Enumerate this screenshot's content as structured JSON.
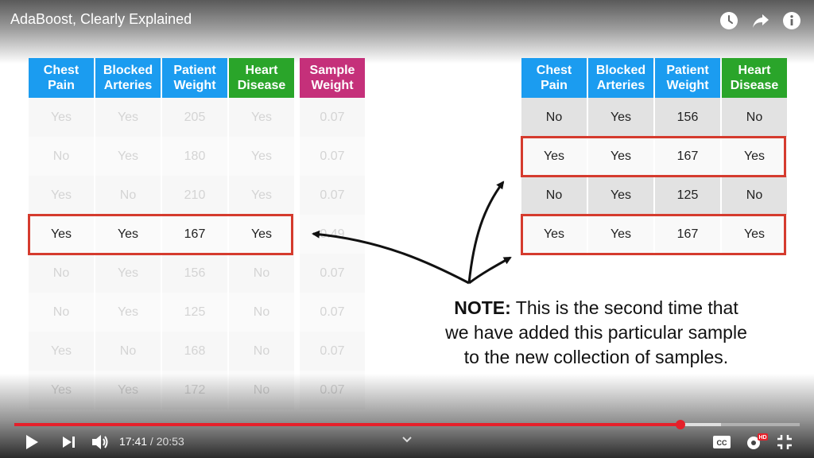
{
  "player": {
    "video_title": "AdaBoost, Clearly Explained",
    "current_time": "17:41",
    "separator": " / ",
    "duration": "20:53",
    "progress_fraction": 0.848,
    "buffered_fraction": 0.9,
    "hd_badge": "HD",
    "icons": [
      "clock-icon",
      "share-icon",
      "info-icon",
      "play-icon",
      "next-icon",
      "volume-icon",
      "chevron-down-icon",
      "captions-icon",
      "settings-icon",
      "exit-fullscreen-icon"
    ],
    "accent_color": "#e5202a"
  },
  "left_table": {
    "headers": [
      {
        "line1": "Chest",
        "line2": "Pain"
      },
      {
        "line1": "Blocked",
        "line2": "Arteries"
      },
      {
        "line1": "Patient",
        "line2": "Weight"
      },
      {
        "line1": "Heart",
        "line2": "Disease"
      }
    ],
    "rows": [
      [
        "Yes",
        "Yes",
        "205",
        "Yes"
      ],
      [
        "No",
        "Yes",
        "180",
        "Yes"
      ],
      [
        "Yes",
        "No",
        "210",
        "Yes"
      ],
      [
        "Yes",
        "Yes",
        "167",
        "Yes"
      ],
      [
        "No",
        "Yes",
        "156",
        "No"
      ],
      [
        "No",
        "Yes",
        "125",
        "No"
      ],
      [
        "Yes",
        "No",
        "168",
        "No"
      ],
      [
        "Yes",
        "Yes",
        "172",
        "No"
      ]
    ],
    "highlighted_row": 3
  },
  "weight_table": {
    "header": {
      "line1": "Sample",
      "line2": "Weight"
    },
    "values": [
      "0.07",
      "0.07",
      "0.07",
      "0.49",
      "0.07",
      "0.07",
      "0.07",
      "0.07"
    ]
  },
  "right_table": {
    "headers": [
      {
        "line1": "Chest",
        "line2": "Pain"
      },
      {
        "line1": "Blocked",
        "line2": "Arteries"
      },
      {
        "line1": "Patient",
        "line2": "Weight"
      },
      {
        "line1": "Heart",
        "line2": "Disease"
      }
    ],
    "rows": [
      [
        "No",
        "Yes",
        "156",
        "No"
      ],
      [
        "Yes",
        "Yes",
        "167",
        "Yes"
      ],
      [
        "No",
        "Yes",
        "125",
        "No"
      ],
      [
        "Yes",
        "Yes",
        "167",
        "Yes"
      ]
    ],
    "highlighted_rows": [
      1,
      3
    ]
  },
  "note": {
    "label": "NOTE:",
    "line1": " This is the second time that",
    "line2": "we have added this particular sample",
    "line3": "to the new collection of samples."
  },
  "colors": {
    "header_blue": "#1b9cf0",
    "header_green": "#2aa52a",
    "header_pink": "#c5307a",
    "highlight_red": "#d53b2e"
  }
}
